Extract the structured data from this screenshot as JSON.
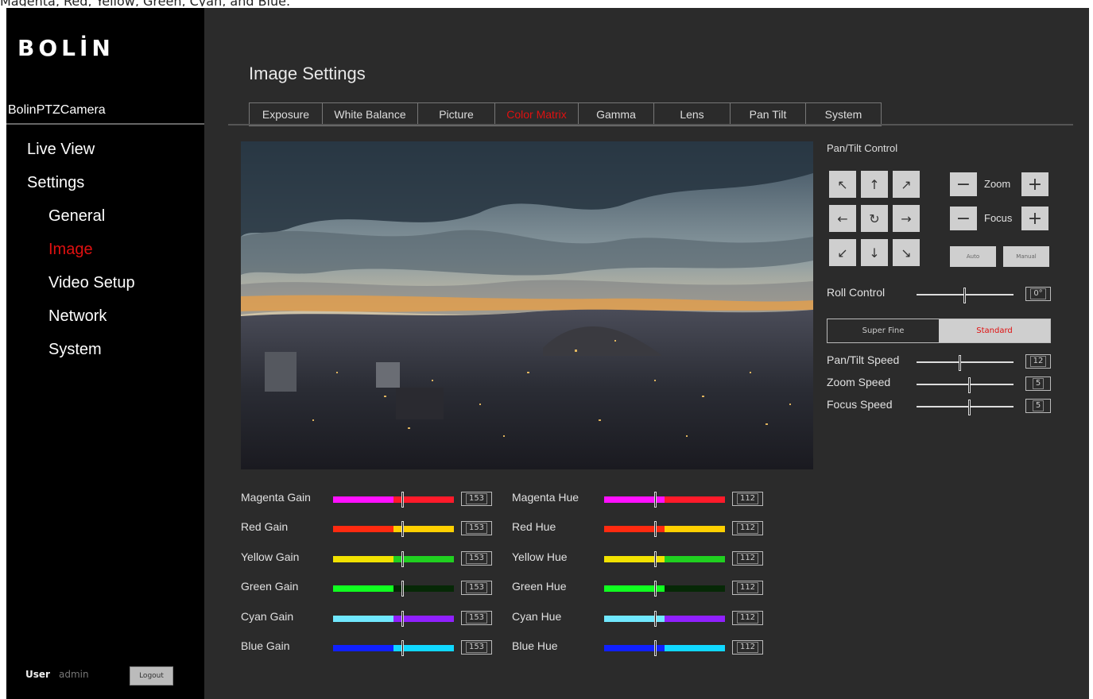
{
  "caption": "Magenta, Red, Yellow, Green, Cyan, and Blue.",
  "sidebar": {
    "logo": "BOLİN",
    "device_name": "BolinPTZCamera",
    "nav": [
      {
        "label": "Live View"
      },
      {
        "label": "Settings"
      },
      {
        "label": "General"
      },
      {
        "label": "Image",
        "active": true
      },
      {
        "label": "Video Setup"
      },
      {
        "label": "Network"
      },
      {
        "label": "System"
      }
    ],
    "user_label": "User",
    "user_name": "admin",
    "logout_label": "Logout"
  },
  "page_title": "Image Settings",
  "tabs": [
    {
      "label": "Exposure"
    },
    {
      "label": "White Balance"
    },
    {
      "label": "Picture"
    },
    {
      "label": "Color Matrix",
      "active": true
    },
    {
      "label": "Gamma"
    },
    {
      "label": "Lens"
    },
    {
      "label": "Pan Tilt"
    },
    {
      "label": "System"
    }
  ],
  "color_matrix": {
    "gains": [
      {
        "label": "Magenta Gain",
        "value": "153",
        "level": 0.58,
        "colors": [
          "#ff10ff",
          "#ff1a2a"
        ]
      },
      {
        "label": "Red Gain",
        "value": "153",
        "level": 0.58,
        "colors": [
          "#ff2a10",
          "#ffd000"
        ]
      },
      {
        "label": "Yellow Gain",
        "value": "153",
        "level": 0.58,
        "colors": [
          "#f2e200",
          "#20d020"
        ]
      },
      {
        "label": "Green Gain",
        "value": "153",
        "level": 0.58,
        "colors": [
          "#10ff20",
          "#062806"
        ]
      },
      {
        "label": "Cyan Gain",
        "value": "153",
        "level": 0.58,
        "colors": [
          "#70e8ff",
          "#9020ff"
        ]
      },
      {
        "label": "Blue Gain",
        "value": "153",
        "level": 0.58,
        "colors": [
          "#1020ff",
          "#10d8ff"
        ]
      }
    ],
    "hues": [
      {
        "label": "Magenta Hue",
        "value": "112",
        "level": 0.43,
        "colors": [
          "#ff10ff",
          "#ff1a2a"
        ]
      },
      {
        "label": "Red Hue",
        "value": "112",
        "level": 0.43,
        "colors": [
          "#ff2a10",
          "#ffd000"
        ]
      },
      {
        "label": "Yellow Hue",
        "value": "112",
        "level": 0.43,
        "colors": [
          "#f2e200",
          "#20d020"
        ]
      },
      {
        "label": "Green Hue",
        "value": "112",
        "level": 0.43,
        "colors": [
          "#10ff20",
          "#062806"
        ]
      },
      {
        "label": "Cyan Hue",
        "value": "112",
        "level": 0.43,
        "colors": [
          "#70e8ff",
          "#9020ff"
        ]
      },
      {
        "label": "Blue Hue",
        "value": "112",
        "level": 0.43,
        "colors": [
          "#1020ff",
          "#10d8ff"
        ]
      }
    ]
  },
  "pan_tilt": {
    "title": "Pan/Tilt Control",
    "arrows": [
      "↖",
      "↑",
      "↗",
      "←",
      "↻",
      "→",
      "↙",
      "↓",
      "↘"
    ],
    "zoom_label": "Zoom",
    "focus_label": "Focus",
    "minus": "−",
    "plus": "+",
    "auto_label": "Auto",
    "manual_label": "Manual",
    "roll_label": "Roll Control",
    "roll_value": "0°",
    "roll_level": 0.5,
    "mode_options": [
      "Super Fine",
      "Standard"
    ],
    "speeds": [
      {
        "label": "Pan/Tilt Speed",
        "value": "12",
        "level": 0.45
      },
      {
        "label": "Zoom Speed",
        "value": "5",
        "level": 0.55
      },
      {
        "label": "Focus Speed",
        "value": "5",
        "level": 0.55
      }
    ]
  },
  "colors": {
    "accent": "#e01010",
    "sidebar_bg": "#000000",
    "main_bg": "#2b2b2b"
  }
}
